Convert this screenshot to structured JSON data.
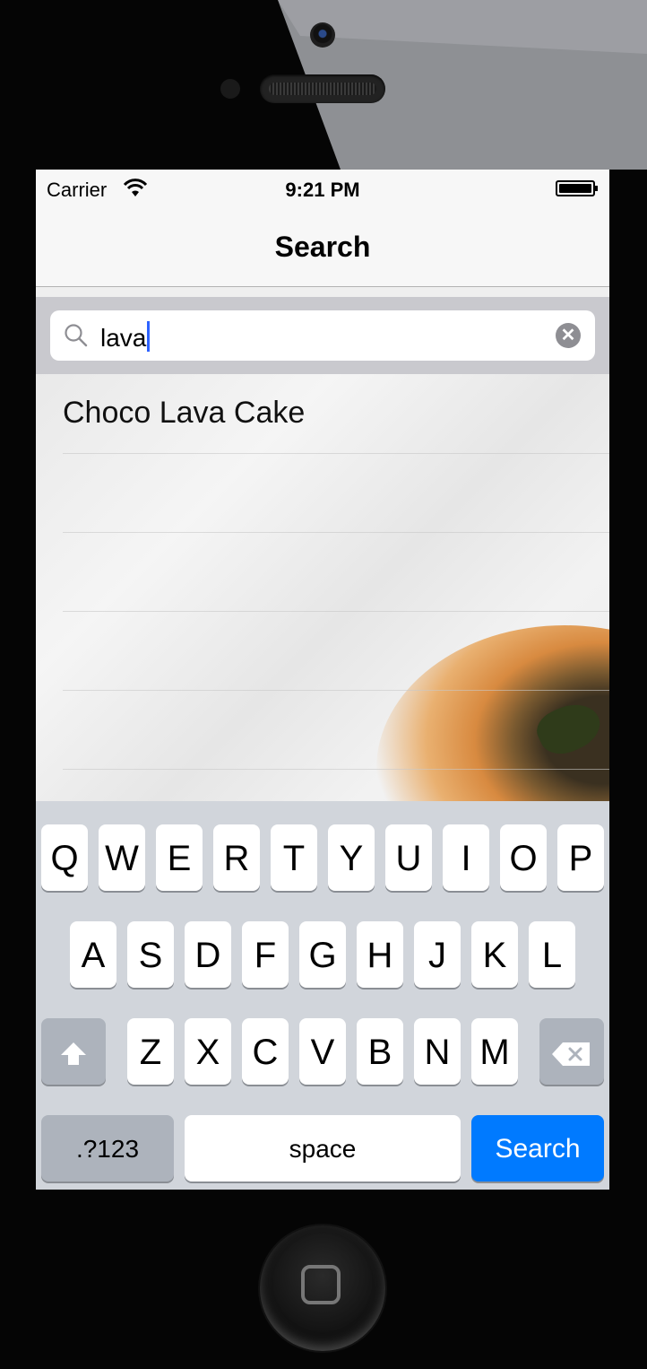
{
  "status_bar": {
    "carrier": "Carrier",
    "time": "9:21 PM"
  },
  "nav": {
    "title": "Search"
  },
  "search": {
    "value": "lava",
    "clear_icon": "clear-icon",
    "search_icon": "magnifier-icon"
  },
  "results": [
    {
      "label": "Choco Lava Cake"
    },
    {
      "label": ""
    },
    {
      "label": ""
    },
    {
      "label": ""
    },
    {
      "label": ""
    }
  ],
  "keyboard": {
    "row1": [
      "Q",
      "W",
      "E",
      "R",
      "T",
      "Y",
      "U",
      "I",
      "O",
      "P"
    ],
    "row2": [
      "A",
      "S",
      "D",
      "F",
      "G",
      "H",
      "J",
      "K",
      "L"
    ],
    "row3": [
      "Z",
      "X",
      "C",
      "V",
      "B",
      "N",
      "M"
    ],
    "numbers_label": ".?123",
    "space_label": "space",
    "search_label": "Search",
    "shift_icon": "shift-icon",
    "delete_icon": "delete-icon"
  },
  "colors": {
    "accent": "#007aff",
    "caret": "#2e63ff",
    "keyboard_bg": "#d1d5db"
  }
}
